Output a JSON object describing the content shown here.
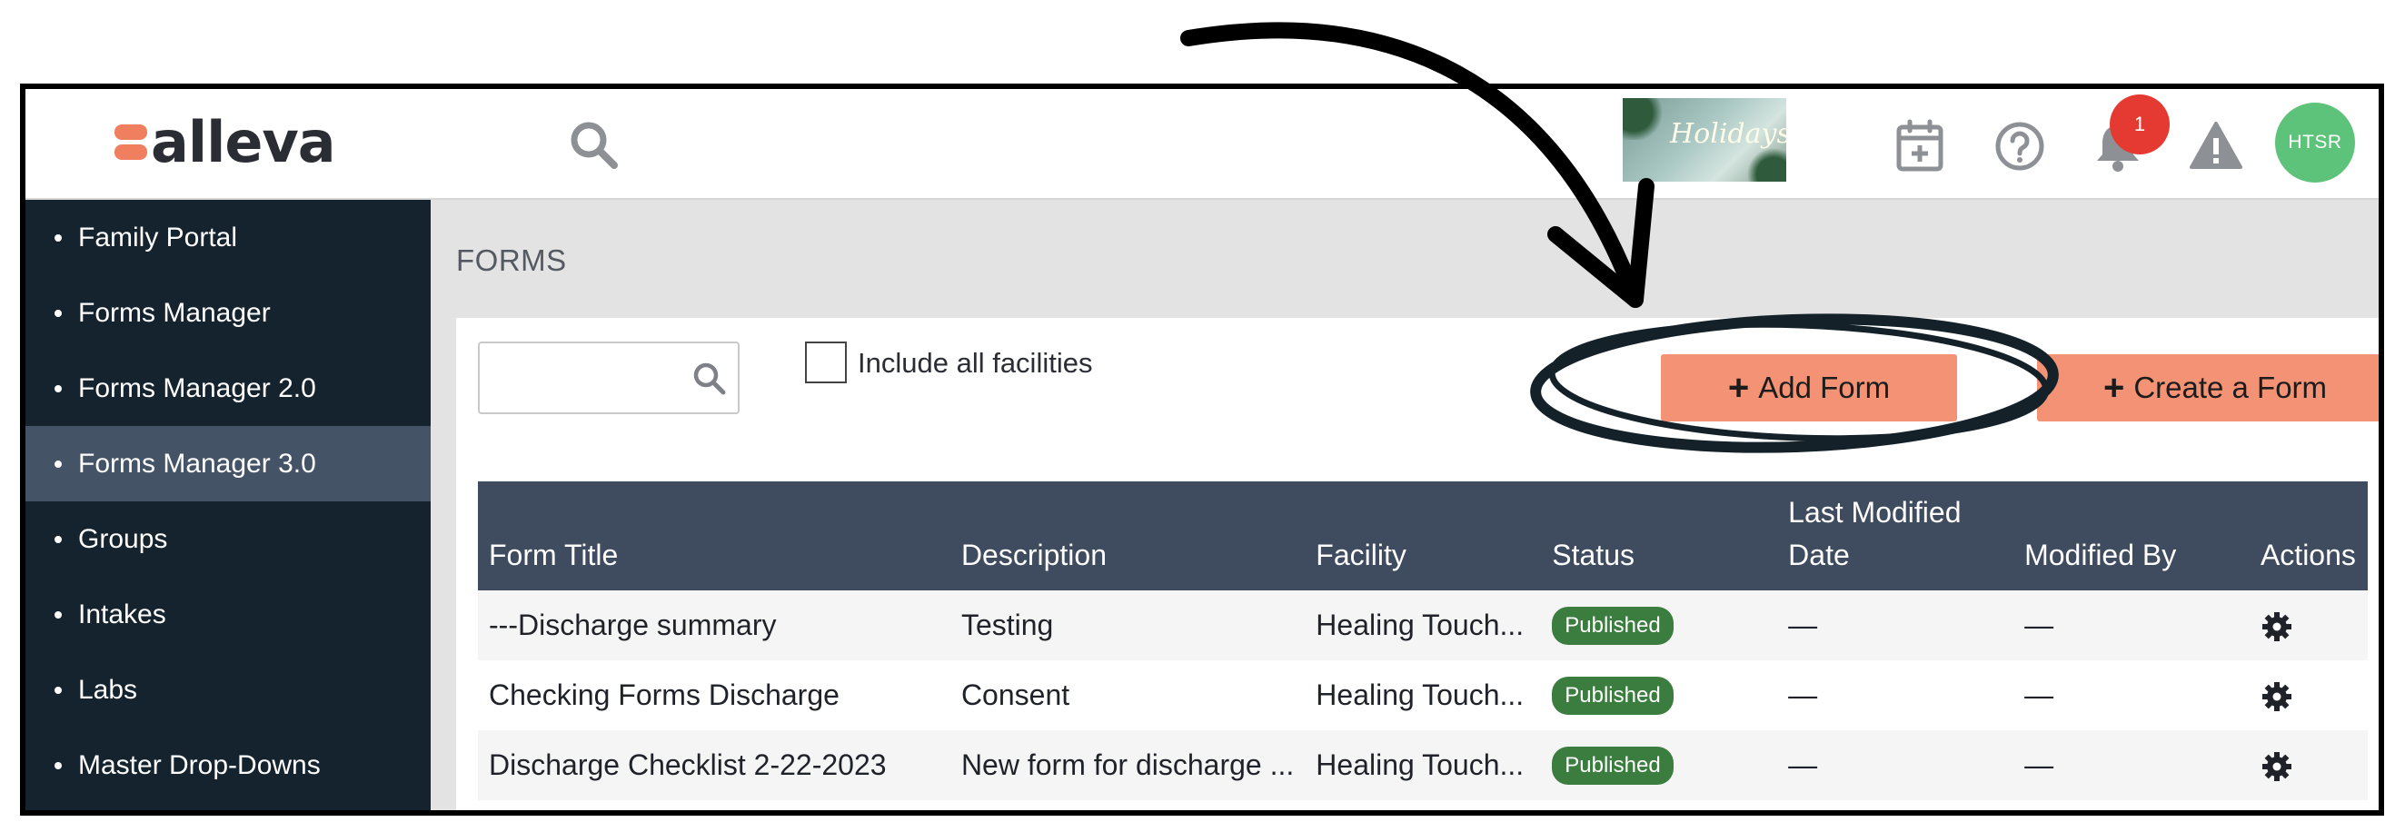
{
  "header": {
    "logo_text": "alleva",
    "notification_count": "1",
    "user_initials": "HTSR",
    "holiday_banner_text": "Holidays",
    "icons": [
      "search-icon",
      "calendar-add-icon",
      "help-icon",
      "bell-icon",
      "warning-icon"
    ]
  },
  "sidebar": {
    "items": [
      {
        "label": "Family Portal"
      },
      {
        "label": "Forms Manager"
      },
      {
        "label": "Forms Manager 2.0"
      },
      {
        "label": "Forms Manager 3.0",
        "active": true
      },
      {
        "label": "Groups"
      },
      {
        "label": "Intakes"
      },
      {
        "label": "Labs"
      },
      {
        "label": "Master Drop-Downs"
      }
    ]
  },
  "main": {
    "page_title": "FORMS",
    "search": {
      "value": "",
      "placeholder": ""
    },
    "include_all_facilities": {
      "label": "Include all facilities",
      "checked": false
    },
    "buttons": {
      "add_form": "Add Form",
      "create_form": "Create a Form"
    },
    "table": {
      "columns": [
        "Form Title",
        "Description",
        "Facility",
        "Status",
        "Last Modified Date",
        "Modified By",
        "Actions"
      ],
      "rows": [
        {
          "title": "---Discharge summary",
          "description": "Testing",
          "facility": "Healing Touch...",
          "status": "Published",
          "last_modified": "—",
          "modified_by": "—"
        },
        {
          "title": "Checking Forms Discharge",
          "description": "Consent",
          "facility": "Healing Touch...",
          "status": "Published",
          "last_modified": "—",
          "modified_by": "—"
        },
        {
          "title": "Discharge Checklist 2-22-2023",
          "description": "New form for discharge ...",
          "facility": "Healing Touch...",
          "status": "Published",
          "last_modified": "—",
          "modified_by": "—"
        }
      ]
    }
  },
  "colors": {
    "sidebar_bg": "#15232f",
    "sidebar_active": "#445366",
    "table_header": "#3f4b5f",
    "button_accent": "#f39274",
    "status_published": "#3a7d3e",
    "notification_badge": "#e43a32",
    "avatar": "#5dc27a",
    "logo_accent": "#ef7f5f"
  }
}
